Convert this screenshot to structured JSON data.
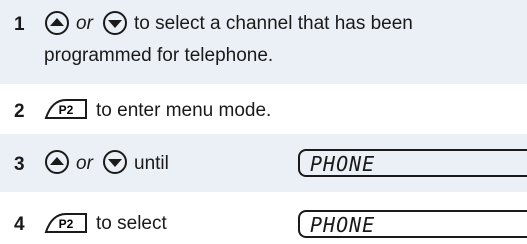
{
  "steps": [
    {
      "number": "1",
      "or": "or",
      "text_line1": "to select a channel that has been",
      "text_line2": "programmed for telephone."
    },
    {
      "number": "2",
      "text": "to enter menu mode."
    },
    {
      "number": "3",
      "or": "or",
      "text": "until",
      "display": "PHONE"
    },
    {
      "number": "4",
      "text": "to select",
      "display": "PHONE"
    }
  ],
  "icons": {
    "up": "up-arrow-button-icon",
    "down": "down-arrow-button-icon",
    "p2": "p2-button-icon",
    "p2_label": "P2"
  }
}
